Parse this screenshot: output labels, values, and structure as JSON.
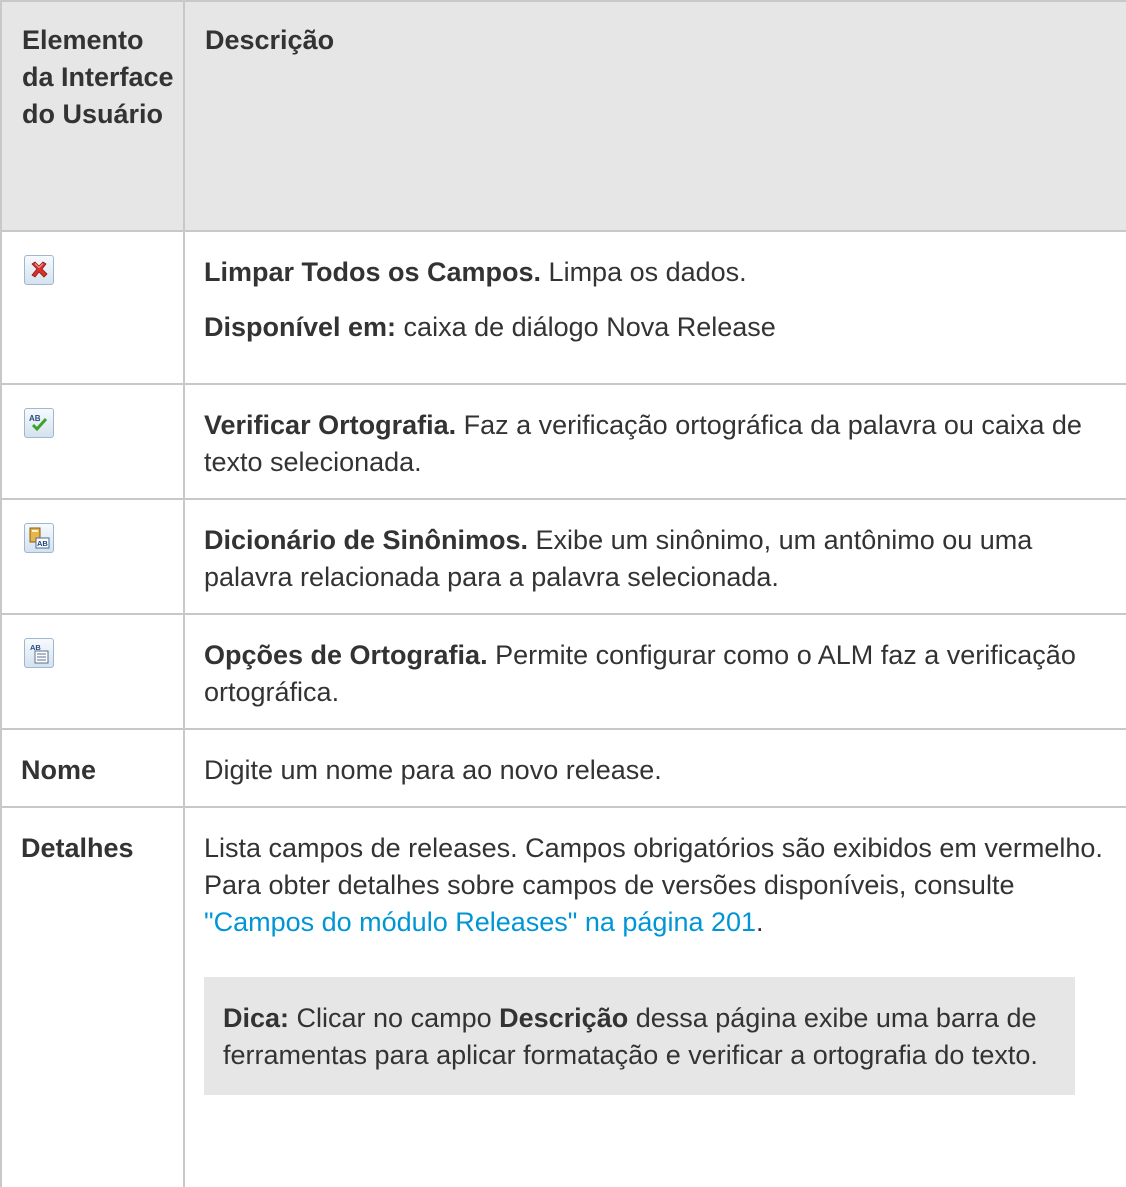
{
  "table": {
    "header": {
      "col1": "Elemento da Interface do Usuário",
      "col2": "Descrição"
    },
    "rows": [
      {
        "icon": "clear-all-fields-icon",
        "title": "Limpar Todos os Campos.",
        "text": " Limpa os dados.",
        "extra_label": "Disponível em:",
        "extra_text": " caixa de diálogo Nova Release"
      },
      {
        "icon": "check-spelling-icon",
        "title": "Verificar Ortografia.",
        "text": " Faz a verificação ortográfica da palavra ou caixa de texto selecionada."
      },
      {
        "icon": "thesaurus-icon",
        "title": "Dicionário de Sinônimos.",
        "text": " Exibe um sinônimo, um antônimo ou uma palavra relacionada para a palavra selecionada."
      },
      {
        "icon": "spelling-options-icon",
        "title": "Opções de Ortografia.",
        "text": " Permite configurar como o ALM faz a verificação ortográfica."
      },
      {
        "label": "Nome",
        "text": "Digite um nome para ao novo release."
      },
      {
        "label": "Detalhes",
        "text_before_link": "Lista campos de releases. Campos obrigatórios são exibidos em vermelho. Para obter detalhes sobre campos de versões disponíveis, consulte ",
        "link_text": "\"Campos do módulo Releases\" na página 201",
        "text_after_link": ".",
        "tip": {
          "label": "Dica:",
          "text_1": " Clicar no campo ",
          "bold_word": "Descrição",
          "text_2": " dessa página exibe uma barra de ferramentas para aplicar formatação e verificar a ortografia do texto."
        }
      }
    ]
  }
}
